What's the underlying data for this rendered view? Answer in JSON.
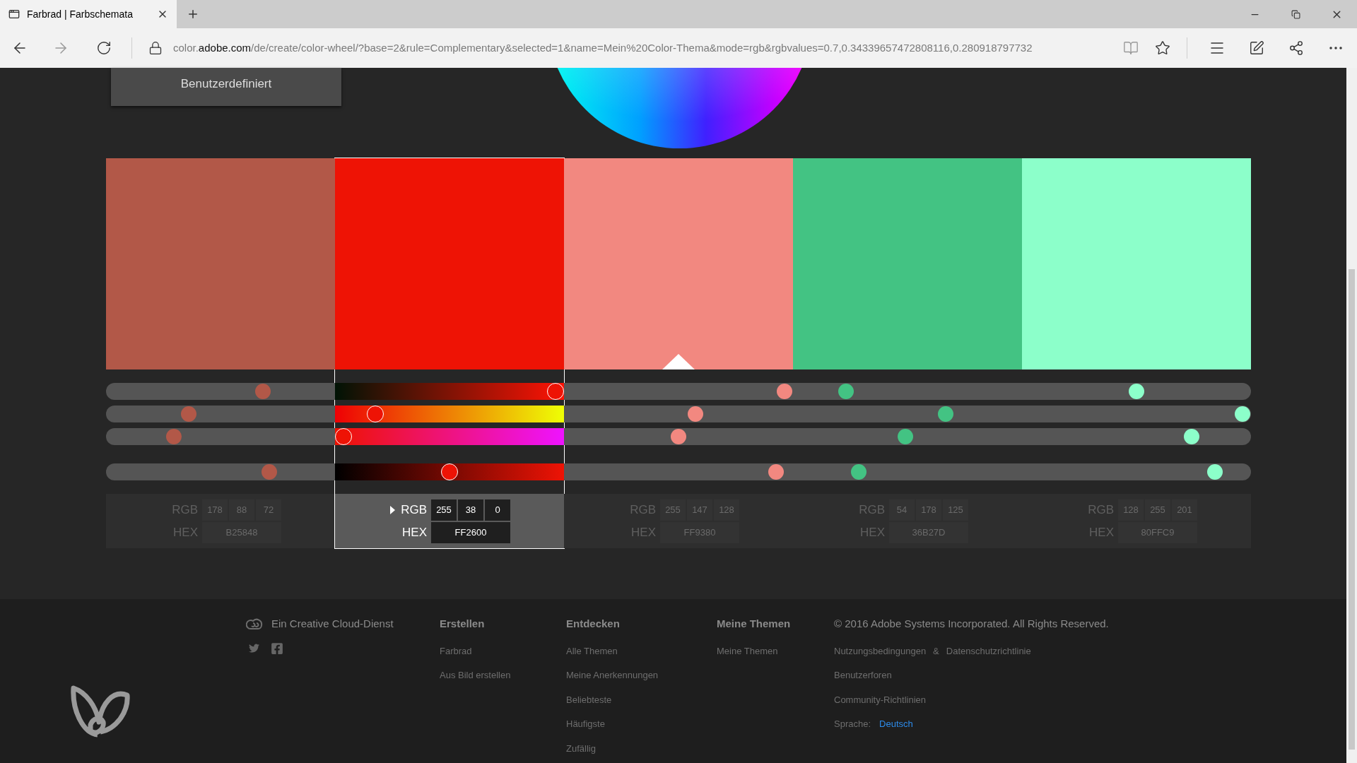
{
  "browser": {
    "tab": {
      "title": "Farbrad | Farbschemata"
    },
    "url": "color.**adobe.com**/de/create/color-wheel/?base=2&rule=Complementary&selected=1&name=Mein%20Color-Thema&mode=rgb&rgbvalues=0.7,0.34339657472808116,0.280918797732"
  },
  "mode_button": {
    "label": "Benutzerdefiniert"
  },
  "swatches": [
    {
      "color": "#b25848",
      "selected": false,
      "base": false,
      "sliders": [
        {
          "level": 0.7
        },
        {
          "level": 0.35
        },
        {
          "level": 0.28
        },
        {
          "level": 0.73
        }
      ],
      "rgb_label": "RGB",
      "rgb": [
        "178",
        "88",
        "72"
      ],
      "hex_label": "HEX",
      "hex": "B25848"
    },
    {
      "color": "#ee1305",
      "selected": true,
      "base": false,
      "sliders": [
        {
          "level": 1.0
        },
        {
          "level": 0.15
        },
        {
          "level": 0.0
        },
        {
          "level": 0.5
        }
      ],
      "rgb_label": "RGB",
      "rgb": [
        "255",
        "38",
        "0"
      ],
      "hex_label": "HEX",
      "hex": "FF2600"
    },
    {
      "color": "#f28880",
      "selected": false,
      "base": true,
      "sliders": [
        {
          "level": 1.0
        },
        {
          "level": 0.58
        },
        {
          "level": 0.5
        },
        {
          "level": 0.96
        }
      ],
      "rgb_label": "RGB",
      "rgb": [
        "255",
        "147",
        "128"
      ],
      "hex_label": "HEX",
      "hex": "FF9380"
    },
    {
      "color": "#43c383",
      "selected": false,
      "base": false,
      "sliders": [
        {
          "level": 0.21
        },
        {
          "level": 0.68
        },
        {
          "level": 0.49
        },
        {
          "level": 0.27
        }
      ],
      "rgb_label": "RGB",
      "rgb": [
        "54",
        "178",
        "125"
      ],
      "hex_label": "HEX",
      "hex": "36B27D"
    },
    {
      "color": "#8cffca",
      "selected": false,
      "base": false,
      "sliders": [
        {
          "level": 0.5
        },
        {
          "level": 1.0
        },
        {
          "level": 0.76
        },
        {
          "level": 0.87
        }
      ],
      "rgb_label": "RGB",
      "rgb": [
        "128",
        "255",
        "201"
      ],
      "hex_label": "HEX",
      "hex": "80FFC9"
    }
  ],
  "footer": {
    "service": "Ein Creative Cloud-Dienst",
    "columns": [
      {
        "heading": "Erstellen",
        "links": [
          "Farbrad",
          "Aus Bild erstellen"
        ]
      },
      {
        "heading": "Entdecken",
        "links": [
          "Alle Themen",
          "Meine Anerkennungen",
          "Beliebteste",
          "Häufigste",
          "Zufällig"
        ]
      },
      {
        "heading": "Meine Themen",
        "links": [
          "Meine Themen"
        ]
      }
    ],
    "copyright": "© 2016 Adobe Systems Incorporated. All Rights Reserved.",
    "legal": {
      "terms": "Nutzungsbedingungen",
      "and": "&",
      "privacy": "Datenschutzrichtlinie"
    },
    "forums": "Benutzerforen",
    "guidelines": "Community-Richtlinien",
    "language_label": "Sprache:",
    "language": "Deutsch"
  }
}
